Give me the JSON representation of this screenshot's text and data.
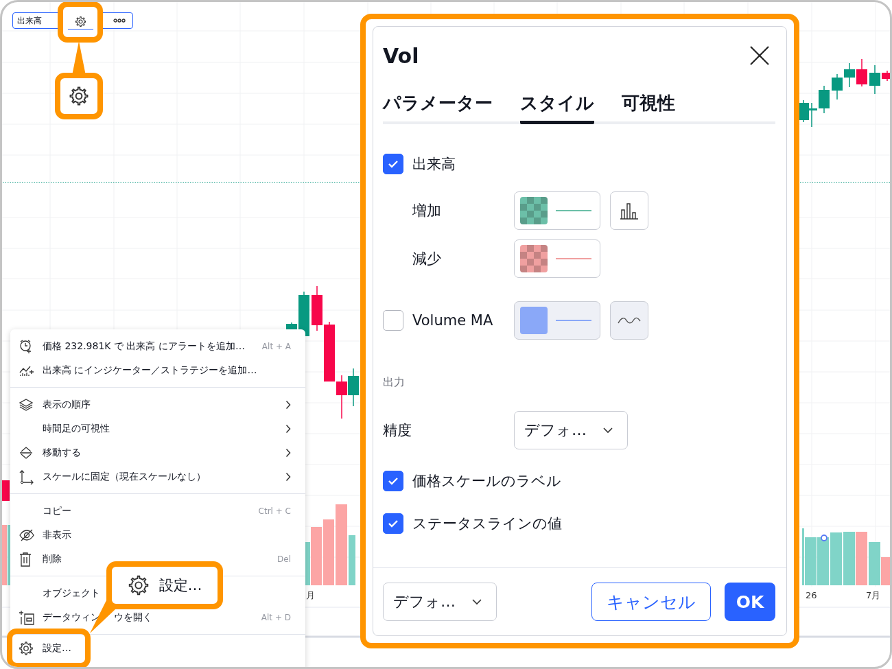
{
  "legend": {
    "title": "出来高"
  },
  "chart": {
    "axis_labels": [
      "月",
      "26",
      "7月"
    ]
  },
  "menu": {
    "groups": [
      [
        {
          "label": "価格 232.981K で 出来高 にアラートを追加…",
          "shortcut": "Alt + A",
          "submenu": false
        },
        {
          "label": "出来高 にインジケーター／ストラテジーを追加…",
          "submenu": false
        }
      ],
      [
        {
          "label": "表示の順序",
          "submenu": true
        },
        {
          "label": "時間足の可視性",
          "submenu": true
        },
        {
          "label": "移動する",
          "submenu": true
        },
        {
          "label": "スケールに固定（現在スケールなし）",
          "submenu": true
        }
      ],
      [
        {
          "label": "コピー",
          "shortcut": "Ctrl + C",
          "submenu": false
        },
        {
          "label": "非表示",
          "submenu": false
        },
        {
          "label": "削除",
          "shortcut": "Del",
          "submenu": false
        }
      ],
      [
        {
          "label": "オブジェクト",
          "submenu": false
        },
        {
          "label": "データウィン",
          "label_after": "ウを開く",
          "shortcut": "Alt + D",
          "submenu": false
        }
      ],
      [
        {
          "label": "設定…",
          "submenu": false
        }
      ]
    ]
  },
  "callout": {
    "label": "設定…"
  },
  "dialog": {
    "title": "Vol",
    "tabs": [
      {
        "label": "パラメーター",
        "selected": false
      },
      {
        "label": "スタイル",
        "selected": true
      },
      {
        "label": "可視性",
        "selected": false
      }
    ],
    "rows": [
      {
        "kind": "checkbox",
        "label": "出来高",
        "checked": true
      },
      {
        "kind": "style",
        "label": "増加",
        "color": "#6cbfa8"
      },
      {
        "kind": "style",
        "label": "減少",
        "color": "#f0a0a0"
      },
      {
        "kind": "checkstyle",
        "label": "Volume MA",
        "checked": false,
        "color": "#8aa8f8"
      },
      {
        "kind": "section",
        "label": "出力"
      },
      {
        "kind": "select",
        "label": "精度",
        "value": "デフォ…"
      },
      {
        "kind": "checkbox",
        "label": "価格スケールのラベル",
        "checked": true
      },
      {
        "kind": "checkbox",
        "label": "ステータスラインの値",
        "checked": true
      }
    ],
    "footer": {
      "preset": "デフォ…",
      "buttons": [
        {
          "label": "キャンセル",
          "kind": "secondary"
        },
        {
          "label": "OK",
          "kind": "primary"
        }
      ]
    }
  }
}
